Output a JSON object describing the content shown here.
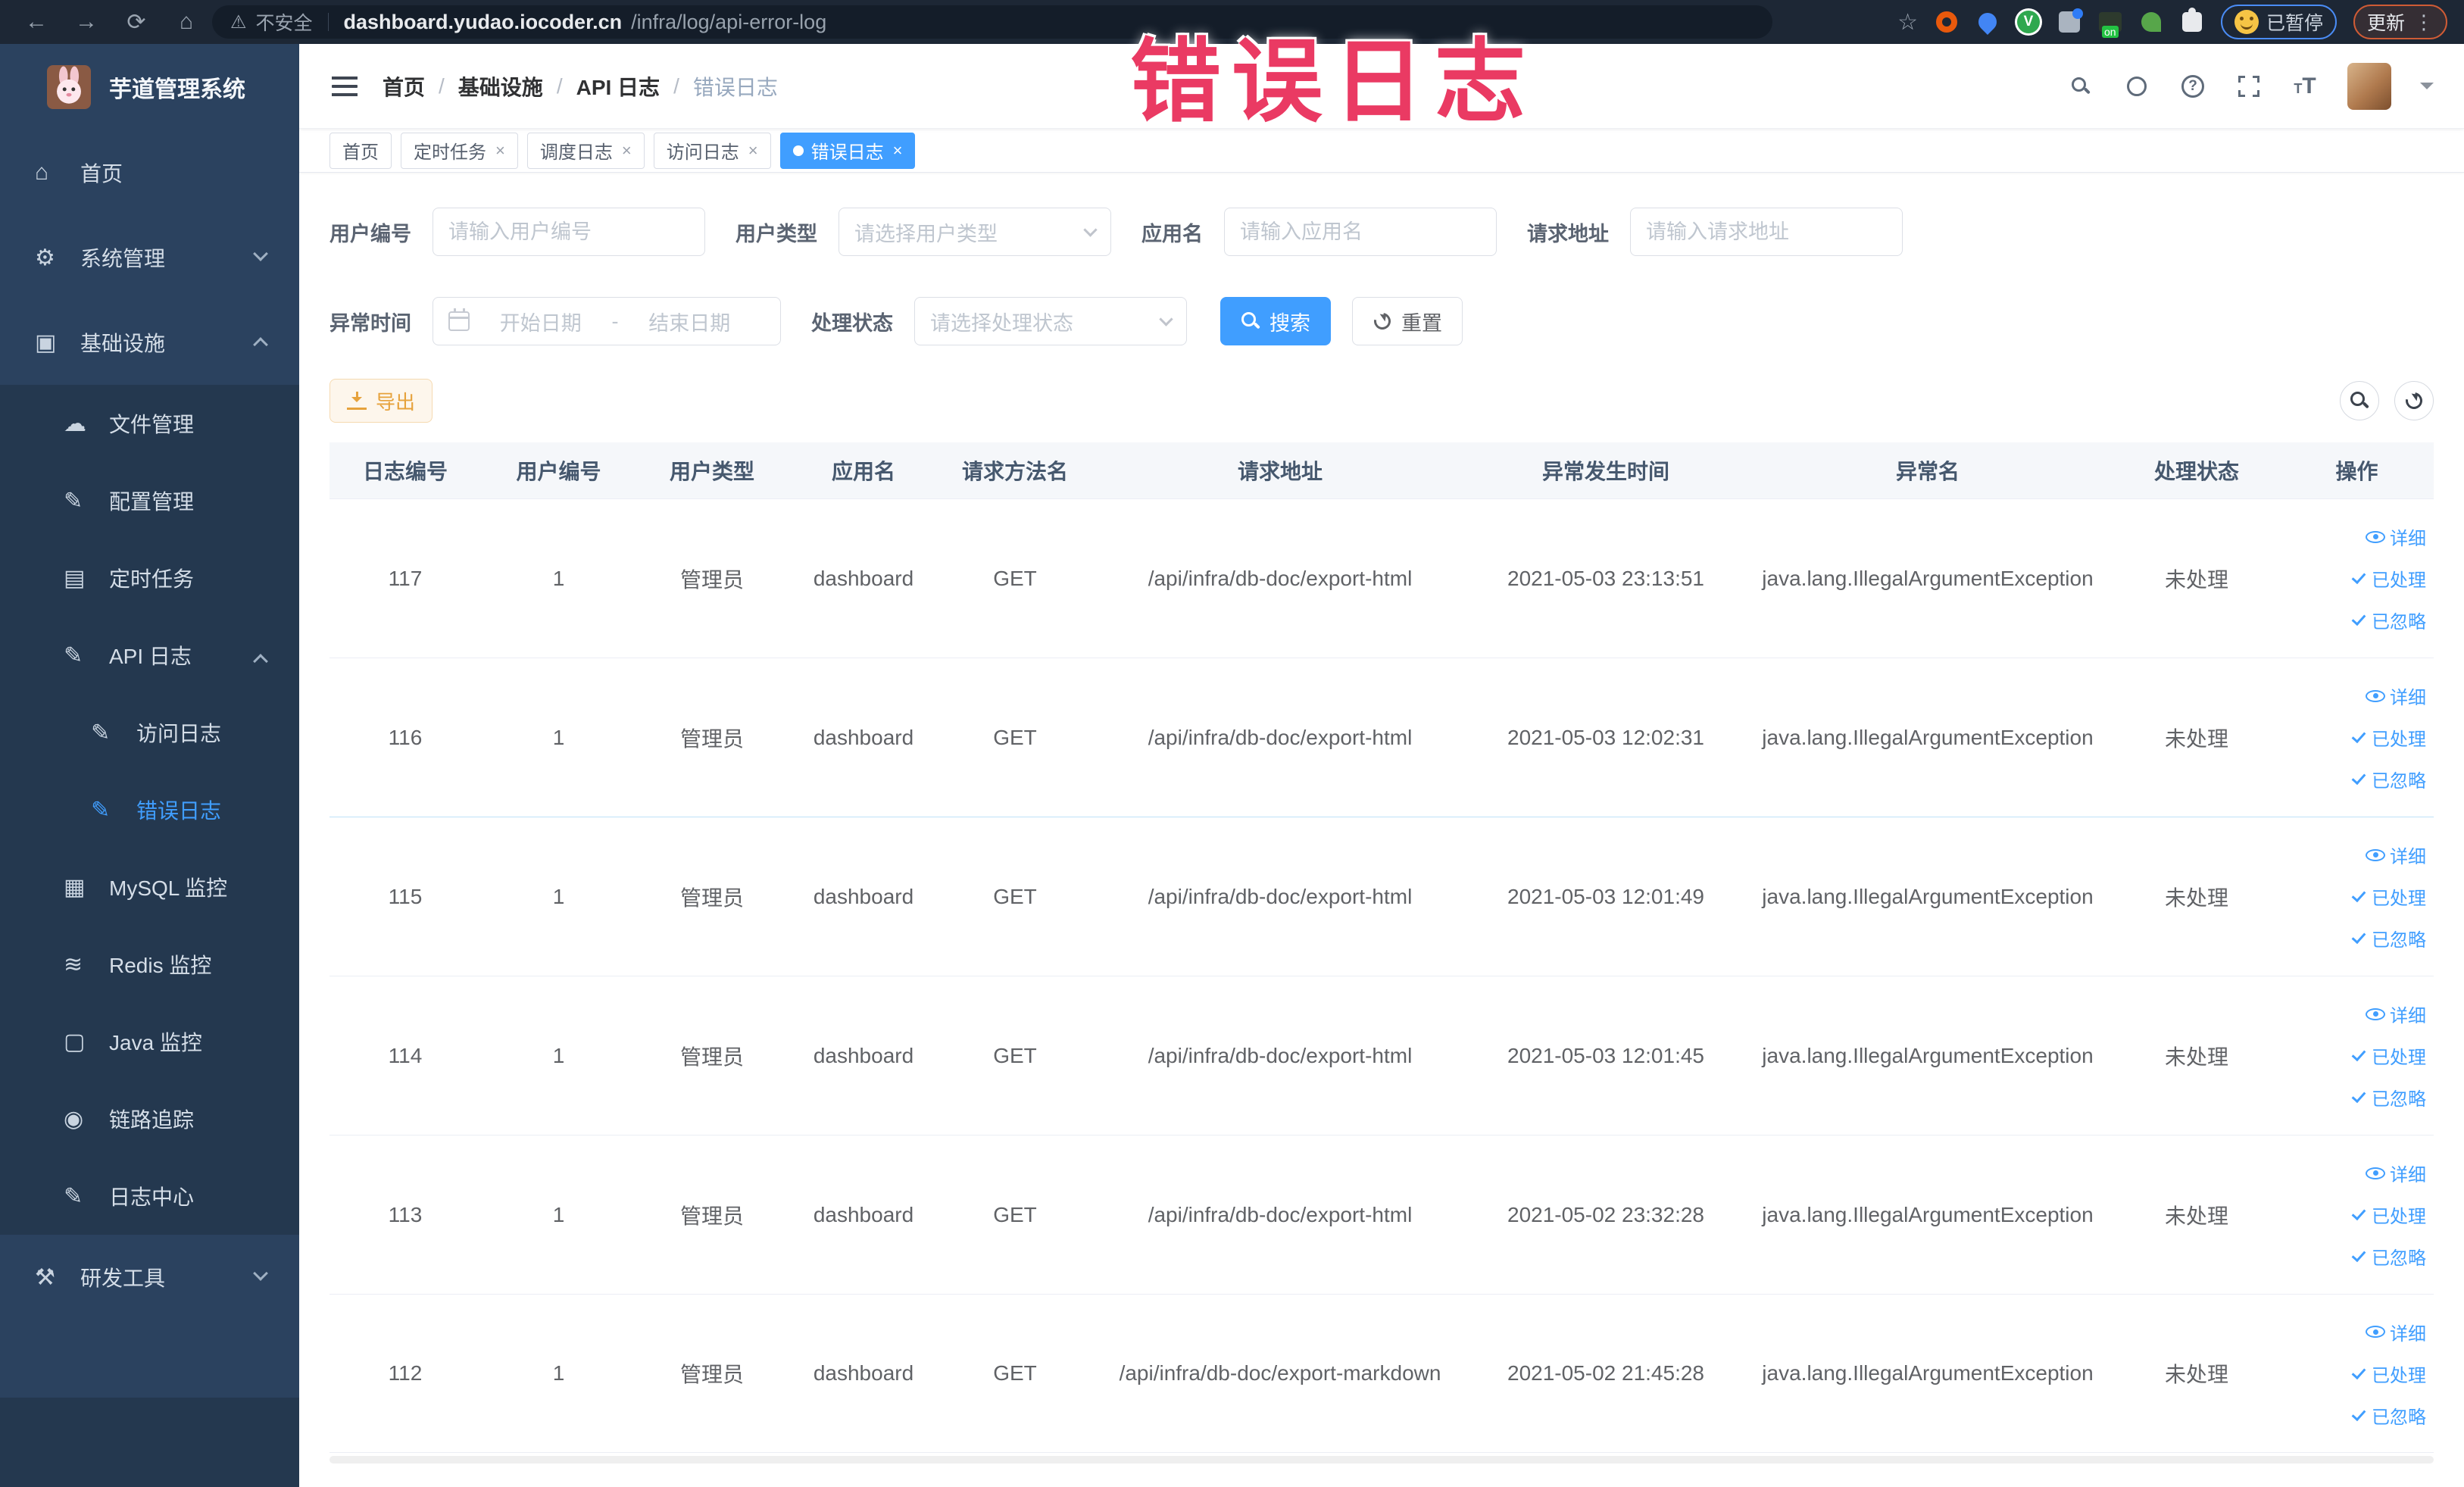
{
  "browser": {
    "security_label": "不安全",
    "url_domain": "dashboard.yudao.iocoder.cn",
    "url_path": "/infra/log/api-error-log",
    "profile_badge": "已暂停",
    "update_button": "更新"
  },
  "overlay": {
    "title": "错误日志"
  },
  "colors": {
    "accent": "#409eff",
    "warning": "#e6a23c",
    "overlay_pink": "#ea3a63",
    "sidebar_bg": "#2b425f",
    "sidebar_submenu_bg": "#24384f",
    "active_tag": "#409eff"
  },
  "sidebar": {
    "logo_title": "芋道管理系统",
    "items": [
      {
        "label": "首页"
      },
      {
        "label": "系统管理"
      },
      {
        "label": "基础设施"
      },
      {
        "label": "文件管理"
      },
      {
        "label": "配置管理"
      },
      {
        "label": "定时任务"
      },
      {
        "label": "API 日志"
      },
      {
        "label": "访问日志"
      },
      {
        "label": "错误日志"
      },
      {
        "label": "MySQL 监控"
      },
      {
        "label": "Redis 监控"
      },
      {
        "label": "Java 监控"
      },
      {
        "label": "链路追踪"
      },
      {
        "label": "日志中心"
      },
      {
        "label": "研发工具"
      }
    ]
  },
  "header": {
    "breadcrumb": [
      "首页",
      "基础设施",
      "API 日志",
      "错误日志"
    ]
  },
  "tags": [
    {
      "label": "首页"
    },
    {
      "label": "定时任务"
    },
    {
      "label": "调度日志"
    },
    {
      "label": "访问日志"
    },
    {
      "label": "错误日志"
    }
  ],
  "filters": {
    "user_id": {
      "label": "用户编号",
      "placeholder": "请输入用户编号"
    },
    "user_type": {
      "label": "用户类型",
      "placeholder": "请选择用户类型"
    },
    "app_name": {
      "label": "应用名",
      "placeholder": "请输入应用名"
    },
    "request_url": {
      "label": "请求地址",
      "placeholder": "请输入请求地址"
    },
    "exception_time": {
      "label": "异常时间",
      "start_placeholder": "开始日期",
      "separator": "-",
      "end_placeholder": "结束日期"
    },
    "process_status": {
      "label": "处理状态",
      "placeholder": "请选择处理状态"
    },
    "search_label": "搜索",
    "reset_label": "重置"
  },
  "toolbar": {
    "export_label": "导出"
  },
  "table": {
    "columns": [
      "日志编号",
      "用户编号",
      "用户类型",
      "应用名",
      "请求方法名",
      "请求地址",
      "异常发生时间",
      "异常名",
      "处理状态",
      "操作"
    ],
    "actions": [
      "详细",
      "已处理",
      "已忽略"
    ],
    "rows": [
      {
        "id": "117",
        "user_id": "1",
        "user_type": "管理员",
        "app": "dashboard",
        "method": "GET",
        "url": "/api/infra/db-doc/export-html",
        "time": "2021-05-03 23:13:51",
        "exception": "java.lang.IllegalArgumentException",
        "status": "未处理"
      },
      {
        "id": "116",
        "user_id": "1",
        "user_type": "管理员",
        "app": "dashboard",
        "method": "GET",
        "url": "/api/infra/db-doc/export-html",
        "time": "2021-05-03 12:02:31",
        "exception": "java.lang.IllegalArgumentException",
        "status": "未处理"
      },
      {
        "id": "115",
        "user_id": "1",
        "user_type": "管理员",
        "app": "dashboard",
        "method": "GET",
        "url": "/api/infra/db-doc/export-html",
        "time": "2021-05-03 12:01:49",
        "exception": "java.lang.IllegalArgumentException",
        "status": "未处理"
      },
      {
        "id": "114",
        "user_id": "1",
        "user_type": "管理员",
        "app": "dashboard",
        "method": "GET",
        "url": "/api/infra/db-doc/export-html",
        "time": "2021-05-03 12:01:45",
        "exception": "java.lang.IllegalArgumentException",
        "status": "未处理"
      },
      {
        "id": "113",
        "user_id": "1",
        "user_type": "管理员",
        "app": "dashboard",
        "method": "GET",
        "url": "/api/infra/db-doc/export-html",
        "time": "2021-05-02 23:32:28",
        "exception": "java.lang.IllegalArgumentException",
        "status": "未处理"
      },
      {
        "id": "112",
        "user_id": "1",
        "user_type": "管理员",
        "app": "dashboard",
        "method": "GET",
        "url": "/api/infra/db-doc/export-markdown",
        "time": "2021-05-02 21:45:28",
        "exception": "java.lang.IllegalArgumentException",
        "status": "未处理"
      }
    ]
  }
}
